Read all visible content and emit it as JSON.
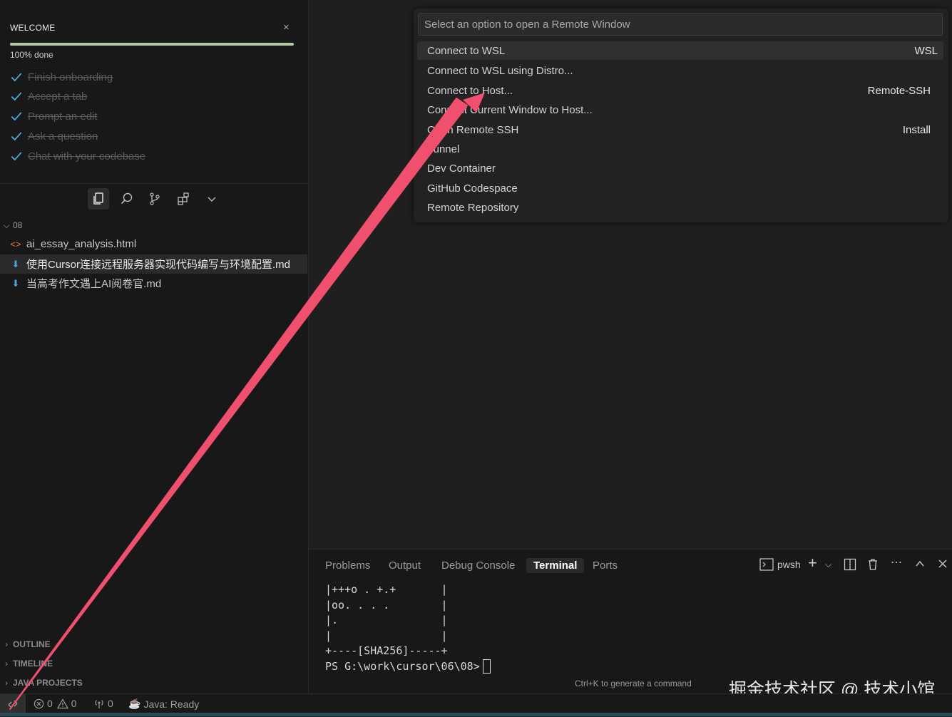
{
  "sidebar": {
    "welcome": {
      "title": "WELCOME",
      "close": "×",
      "progress_label": "100% done",
      "progress": 1.0,
      "tasks": [
        {
          "label": "Finish onboarding"
        },
        {
          "label": "Accept a tab"
        },
        {
          "label": "Prompt an edit"
        },
        {
          "label": "Ask a question"
        },
        {
          "label": "Chat with your codebase"
        }
      ]
    },
    "toolbar_icons": [
      "explorer-icon",
      "search-icon",
      "source-control-icon",
      "extensions-icon",
      "chevron-down-icon"
    ],
    "folder": "08",
    "files": [
      {
        "icon": "<>",
        "name": "ai_essay_analysis.html"
      },
      {
        "icon": "⬇",
        "name": "使用Cursor连接远程服务器实现代码编写与环境配置.md"
      },
      {
        "icon": "⬇",
        "name": "当高考作文遇上AI阅卷官.md"
      }
    ],
    "sections": [
      {
        "label": "OUTLINE"
      },
      {
        "label": "TIMELINE"
      },
      {
        "label": "JAVA PROJECTS"
      }
    ]
  },
  "quickpick": {
    "placeholder": "Select an option to open a Remote Window",
    "items": [
      {
        "label": "Connect to WSL",
        "desc": "WSL"
      },
      {
        "label": "Connect to WSL using Distro...",
        "desc": ""
      },
      {
        "label": "Connect to Host...",
        "desc": "Remote-SSH"
      },
      {
        "label": "Connect Current Window to Host...",
        "desc": ""
      },
      {
        "label": "Open Remote SSH",
        "desc": "Install"
      },
      {
        "label": "Tunnel",
        "desc": ""
      },
      {
        "label": "Dev Container",
        "desc": ""
      },
      {
        "label": "GitHub Codespace",
        "desc": ""
      },
      {
        "label": "Remote Repository",
        "desc": ""
      }
    ]
  },
  "panel": {
    "tabs": [
      "Problems",
      "Output",
      "Debug Console",
      "Terminal",
      "Ports"
    ],
    "active_tab": "Terminal",
    "shell": "pwsh",
    "terminal_lines": [
      "|+++o . +.+       |",
      "|oo. . . .        |",
      "|.                |",
      "|                 |",
      "+----[SHA256]-----+"
    ],
    "prompt": "PS G:\\work\\cursor\\06\\08>",
    "hint": "Ctrl+K to generate a command"
  },
  "statusbar": {
    "errors": "0",
    "warnings": "0",
    "ports": "0",
    "java": "Java: Ready"
  },
  "watermark": "掘金技术社区 @ 技术小馆",
  "colors": {
    "arrow": "#f0506e",
    "progress": "#b7c9a0",
    "check": "#4aa8e0"
  }
}
